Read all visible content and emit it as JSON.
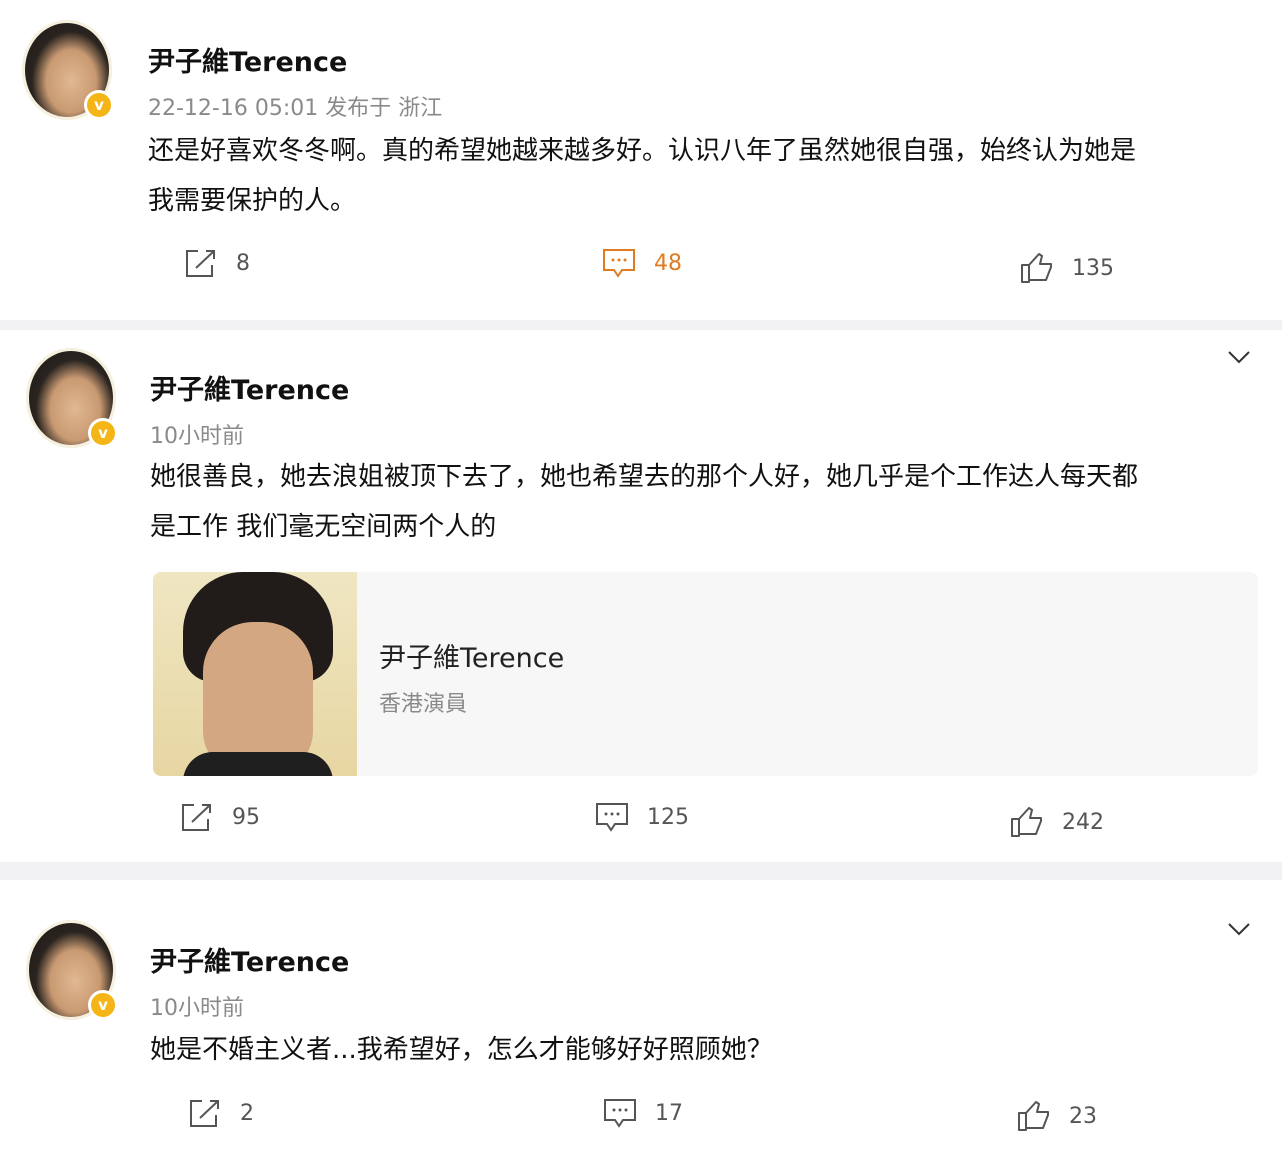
{
  "posts": [
    {
      "author": "尹子維Terence",
      "meta": "22-12-16 05:01 发布于 浙江",
      "text_lines": [
        "还是好喜欢冬冬啊。真的希望她越来越多好。认识八年了虽然她很自强，始终认为她是",
        "我需要保护的人。"
      ],
      "reposts": "8",
      "comments": "48",
      "likes": "135"
    },
    {
      "author": "尹子維Terence",
      "meta": "10小时前",
      "text_lines": [
        "她很善良，她去浪姐被顶下去了，她也希望去的那个人好，她几乎是个工作达人每天都",
        "是工作 我们毫无空间两个人的"
      ],
      "card": {
        "name": "尹子維Terence",
        "desc": "香港演員"
      },
      "reposts": "95",
      "comments": "125",
      "likes": "242"
    },
    {
      "author": "尹子維Terence",
      "meta": "10小时前",
      "text_lines": [
        "她是不婚主义者...我希望好，怎么才能够好好照顾她？"
      ],
      "reposts": "2",
      "comments": "17",
      "likes": "23"
    }
  ],
  "icons": {
    "repost": "repost-icon",
    "comment": "comment-icon",
    "like": "like-icon",
    "expand": "chevron-down-icon",
    "verified": "verified-badge-icon"
  },
  "colors": {
    "accent": "#e07b22",
    "verified": "#f5b516",
    "muted": "#8a8a8a",
    "separator": "#f2f2f4"
  }
}
